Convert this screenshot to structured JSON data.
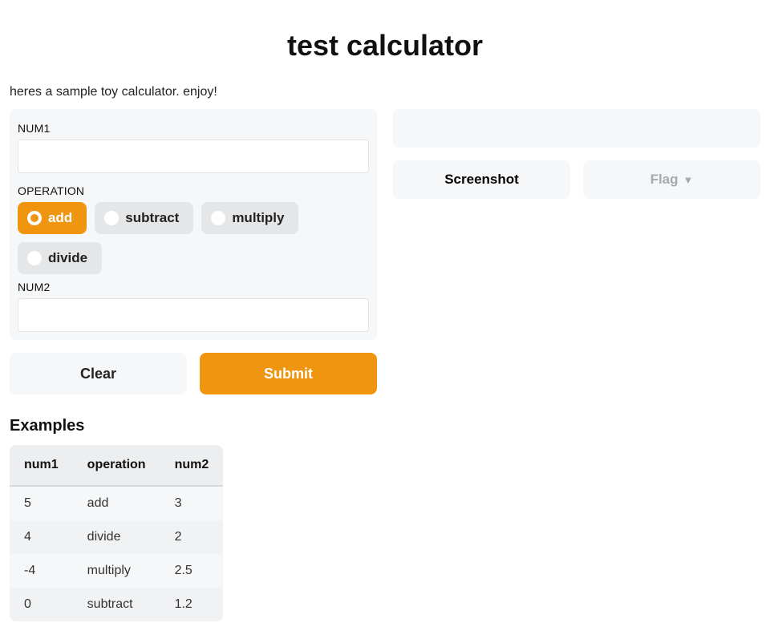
{
  "title": "test calculator",
  "subtitle": "heres a sample toy calculator. enjoy!",
  "inputs": {
    "num1": {
      "label": "NUM1",
      "value": ""
    },
    "operation": {
      "label": "OPERATION",
      "selected": "add",
      "options": [
        "add",
        "subtract",
        "multiply",
        "divide"
      ]
    },
    "num2": {
      "label": "NUM2",
      "value": ""
    }
  },
  "buttons": {
    "clear": "Clear",
    "submit": "Submit",
    "screenshot": "Screenshot",
    "flag": "Flag"
  },
  "examples": {
    "title": "Examples",
    "columns": [
      "num1",
      "operation",
      "num2"
    ],
    "rows": [
      {
        "num1": "5",
        "operation": "add",
        "num2": "3"
      },
      {
        "num1": "4",
        "operation": "divide",
        "num2": "2"
      },
      {
        "num1": "-4",
        "operation": "multiply",
        "num2": "2.5"
      },
      {
        "num1": "0",
        "operation": "subtract",
        "num2": "1.2"
      }
    ]
  },
  "colors": {
    "accent": "#f0950f",
    "panel": "#f6f7f8",
    "pill": "#e5e6e7"
  }
}
